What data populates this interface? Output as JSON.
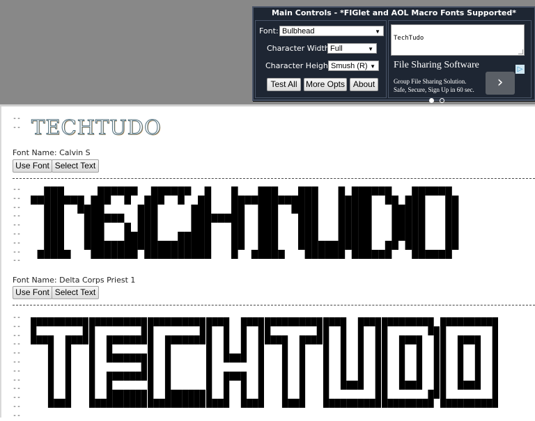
{
  "controls": {
    "title": "Main Controls - *FIGlet and AOL Macro Fonts Supported*",
    "font_label": "Font:",
    "font_value": "Bulbhead",
    "width_label": "Character Width:",
    "width_value": "Full",
    "height_label": "Character Height:",
    "height_value": "Smush (R)",
    "test_all": "Test All",
    "more_opts": "More Opts",
    "about": "About",
    "input_text": "TechTudo"
  },
  "ad": {
    "title": "File Sharing Software",
    "line1": "Group File Sharing Solution.",
    "line2": "Safe, Secure, Sign Up in 60 sec.",
    "arrow": "›",
    "badge": "▷",
    "dots": [
      true,
      false
    ]
  },
  "results": [
    {
      "art_text": "TECHTUDO",
      "font_name_label": "Font Name: Calvin S",
      "use_font": "Use Font",
      "select_text": "Select Text",
      "dashes": "--\n--"
    },
    {
      "art_text": "TECHTUDO",
      "font_name_label": "Font Name: Delta Corps Priest 1",
      "use_font": "Use Font",
      "select_text": "Select Text",
      "dashes": "--\n--\n--\n--\n--\n--\n--\n--\n--"
    },
    {
      "art_text": "TECHTUDO",
      "dashes": "--\n--\n--\n--\n--\n--\n--\n--\n--\n--\n--\n--"
    }
  ],
  "colors": {
    "panel_bg": "#1e2633",
    "page_top_bg": "#888888",
    "block_fill": "#000000",
    "block_light": "#d8d8d8"
  }
}
